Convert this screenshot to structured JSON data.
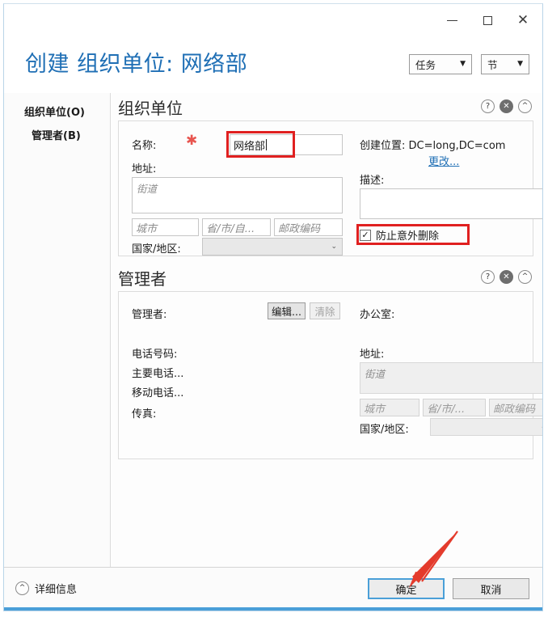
{
  "window": {
    "minimize_icon": "minimize-icon",
    "maximize_icon": "maximize-icon",
    "close_icon": "close-icon",
    "close_glyph": "✕"
  },
  "header": {
    "title": "创建 组织单位: 网络部",
    "title_color": "#1f6fb5",
    "task_button": "任务",
    "section_button": "节",
    "caret_glyph": "▼"
  },
  "sidebar": {
    "items": [
      {
        "label": "组织单位(O)"
      },
      {
        "label": "管理者(B)"
      }
    ]
  },
  "sections": [
    {
      "title": "组织单位",
      "help_glyph": "?",
      "close_glyph": "✕",
      "collapse_glyph": "^",
      "fields": {
        "name_label": "名称:",
        "name_value": "网络部",
        "required_marker": "✱",
        "address_label": "地址:",
        "street_placeholder": "街道",
        "city_placeholder": "城市",
        "state_placeholder": "省/市/自...",
        "zip_placeholder": "邮政编码",
        "country_label": "国家/地区:",
        "country_value": "",
        "create_in_label": "创建位置:",
        "create_in_value": "DC=long,DC=com",
        "change_link": "更改...",
        "description_label": "描述:",
        "description_value": "",
        "protect_checkbox_label": "防止意外删除",
        "protect_checkbox_checked": "✓"
      }
    },
    {
      "title": "管理者",
      "help_glyph": "?",
      "close_glyph": "✕",
      "collapse_glyph": "^",
      "fields": {
        "manager_label": "管理者:",
        "edit_button": "编辑...",
        "clear_button": "清除",
        "office_label": "办公室:",
        "phone_label": "电话号码:",
        "main_phone_label": "主要电话...",
        "mobile_phone_label": "移动电话...",
        "fax_label": "传真:",
        "address_label": "地址:",
        "street_placeholder": "街道",
        "city_placeholder": "城市",
        "state_placeholder": "省/市/...",
        "zip_placeholder": "邮政编码",
        "country_label": "国家/地区:"
      }
    }
  ],
  "footer": {
    "details_label": "详细信息",
    "details_glyph": "^",
    "ok_button": "确定",
    "cancel_button": "取消"
  },
  "annotations": {
    "highlight_color": "#e02020",
    "arrow_color": "#e43b2c"
  }
}
